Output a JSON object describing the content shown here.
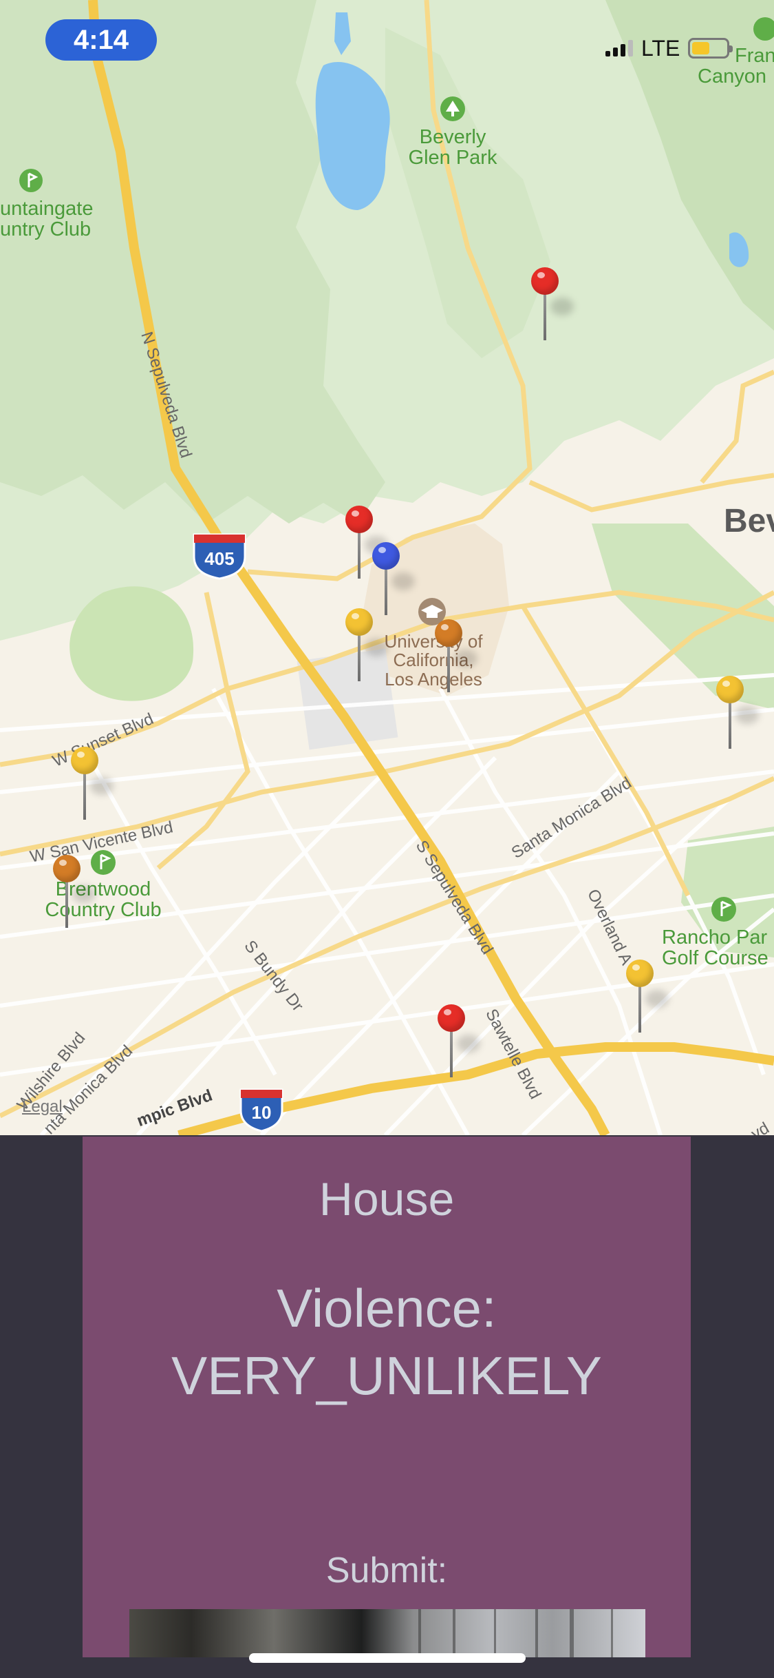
{
  "status_bar": {
    "time": "4:14",
    "network": "LTE",
    "battery_color": "#f5c629",
    "battery_level_fraction": 0.45
  },
  "map": {
    "labels": {
      "beverly_glen_park_line1": "Beverly",
      "beverly_glen_park_line2": "Glen Park",
      "country_club_top_line1": "untaingate",
      "country_club_top_line2": "untry Club",
      "franklin_canyon_line1": "Fran",
      "franklin_canyon_line2": "Canyon",
      "ucla_line1": "University of",
      "ucla_line2": "California,",
      "ucla_line3": "Los Angeles",
      "brentwood_line1": "Brentwood",
      "brentwood_line2": "Country Club",
      "rancho_line1": "Rancho Par",
      "rancho_line2": "Golf Course",
      "beverly_hills_partial": "Bev",
      "n_sepulveda": "N Sepulveda Blvd",
      "w_sunset": "W Sunset Blvd",
      "w_san_vicente": "W San Vicente Blvd",
      "santa_monica_blvd": "Santa Monica Blvd",
      "s_sepulveda": "S Sepulveda Blvd",
      "overland": "Overland A",
      "s_bundy": "S Bundy Dr",
      "sawtelle": "Sawtelle Blvd",
      "wilshire": "Wilshire Blvd",
      "santa_monica_lower": "nta Monica Blvd",
      "olympic": "mpic Blvd",
      "corner_partial": "vd"
    },
    "shields": {
      "i405": "405",
      "i10": "10"
    },
    "legal": "Legal",
    "pins": [
      {
        "color": "#e52d27"
      },
      {
        "color": "#e52d27"
      },
      {
        "color": "#3f59e0"
      },
      {
        "color": "#f3c233"
      },
      {
        "color": "#d37c26"
      },
      {
        "color": "#f3c233"
      },
      {
        "color": "#f3c233"
      },
      {
        "color": "#d37c26"
      },
      {
        "color": "#f3c233"
      },
      {
        "color": "#e52d27"
      }
    ]
  },
  "panel": {
    "title": "House",
    "violence_line1": "Violence:",
    "violence_line2": "VERY_UNLIKELY",
    "submit_label": "Submit:",
    "background": "#7b4b6f"
  }
}
